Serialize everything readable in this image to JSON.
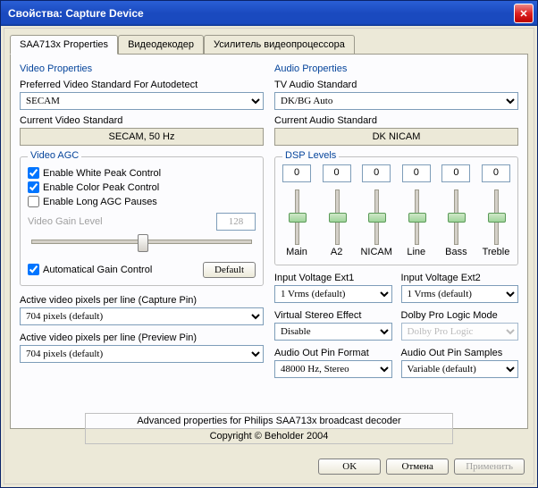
{
  "window": {
    "title": "Свойства: Capture Device"
  },
  "tabs": {
    "active": "SAA713x Properties",
    "t1": "Видеодекодер",
    "t2": "Усилитель видеопроцессора"
  },
  "video": {
    "title": "Video Properties",
    "prefStdLabel": "Preferred Video Standard For Autodetect",
    "prefStd": "SECAM",
    "curStdLabel": "Current Video Standard",
    "curStd": "SECAM, 50 Hz",
    "agc": {
      "title": "Video AGC",
      "whitePeakLabel": "Enable White Peak Control",
      "whitePeak": true,
      "colorPeakLabel": "Enable Color Peak Control",
      "colorPeak": true,
      "longPausesLabel": "Enable Long AGC Pauses",
      "longPauses": false,
      "gainLabel": "Video Gain Level",
      "gainValue": "128",
      "autoGainLabel": "Automatical Gain Control",
      "autoGain": true,
      "defaultBtn": "Default"
    },
    "capPinLabel": "Active video pixels per line (Capture Pin)",
    "capPin": "704 pixels (default)",
    "prevPinLabel": "Active video pixels per line (Preview Pin)",
    "prevPin": "704 pixels (default)"
  },
  "audio": {
    "title": "Audio Properties",
    "tvStdLabel": "TV Audio Standard",
    "tvStd": "DK/BG Auto",
    "curStdLabel": "Current Audio Standard",
    "curStd": "DK NICAM",
    "dsp": {
      "title": "DSP Levels",
      "channels": [
        {
          "name": "Main",
          "value": "0",
          "pos": 0.5
        },
        {
          "name": "A2",
          "value": "0",
          "pos": 0.5
        },
        {
          "name": "NICAM",
          "value": "0",
          "pos": 0.5
        },
        {
          "name": "Line",
          "value": "0",
          "pos": 0.5
        },
        {
          "name": "Bass",
          "value": "0",
          "pos": 0.5
        },
        {
          "name": "Treble",
          "value": "0",
          "pos": 0.5
        }
      ]
    },
    "ext1Label": "Input Voltage Ext1",
    "ext1": "1 Vrms (default)",
    "ext2Label": "Input Voltage Ext2",
    "ext2": "1 Vrms (default)",
    "vseLabel": "Virtual Stereo Effect",
    "vse": "Disable",
    "dolbyLabel": "Dolby Pro Logic Mode",
    "dolby": "Dolby Pro Logic",
    "outFmtLabel": "Audio Out Pin Format",
    "outFmt": "48000 Hz, Stereo",
    "outSmpLabel": "Audio Out Pin Samples",
    "outSmp": "Variable (default)"
  },
  "footer": {
    "line1": "Advanced properties for Philips SAA713x broadcast decoder",
    "line2": "Copyright © Beholder 2004"
  },
  "buttons": {
    "ok": "OK",
    "cancel": "Отмена",
    "apply": "Применить"
  }
}
